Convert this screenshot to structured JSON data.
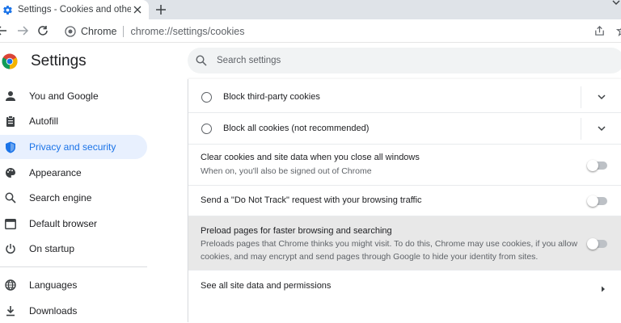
{
  "tab": {
    "title": "Settings - Cookies and other site",
    "close_label": "✕",
    "new_tab_label": "+"
  },
  "omnibox": {
    "site_chip": "Chrome",
    "url": "chrome://settings/cookies"
  },
  "header": {
    "title": "Settings",
    "search_placeholder": "Search settings"
  },
  "sidebar": {
    "items": [
      {
        "label": "You and Google",
        "icon": "person-icon"
      },
      {
        "label": "Autofill",
        "icon": "clipboard-icon"
      },
      {
        "label": "Privacy and security",
        "icon": "shield-icon",
        "active": true
      },
      {
        "label": "Appearance",
        "icon": "palette-icon"
      },
      {
        "label": "Search engine",
        "icon": "search-icon"
      },
      {
        "label": "Default browser",
        "icon": "browser-window-icon"
      },
      {
        "label": "On startup",
        "icon": "power-icon"
      },
      {
        "label": "Languages",
        "icon": "globe-icon"
      },
      {
        "label": "Downloads",
        "icon": "download-icon"
      }
    ]
  },
  "main": {
    "block_third_party": "Block third-party cookies",
    "block_all": "Block all cookies (not recommended)",
    "clear_on_close": {
      "title": "Clear cookies and site data when you close all windows",
      "subtitle": "When on, you'll also be signed out of Chrome",
      "enabled": false
    },
    "do_not_track": {
      "title": "Send a \"Do Not Track\" request with your browsing traffic",
      "enabled": false
    },
    "preload": {
      "title": "Preload pages for faster browsing and searching",
      "subtitle_line1": "Preloads pages that Chrome thinks you might visit. To do this, Chrome may use cookies, if you allow",
      "subtitle_line2": "cookies, and may encrypt and send pages through Google to hide your identity from sites.",
      "enabled": false
    },
    "see_all": "See all site data and permissions"
  },
  "colors": {
    "accent": "#1a73e8",
    "active_bg": "#e8f0fe",
    "tabstrip": "#dfe3e8",
    "highlight_row": "#e8e8e8"
  }
}
